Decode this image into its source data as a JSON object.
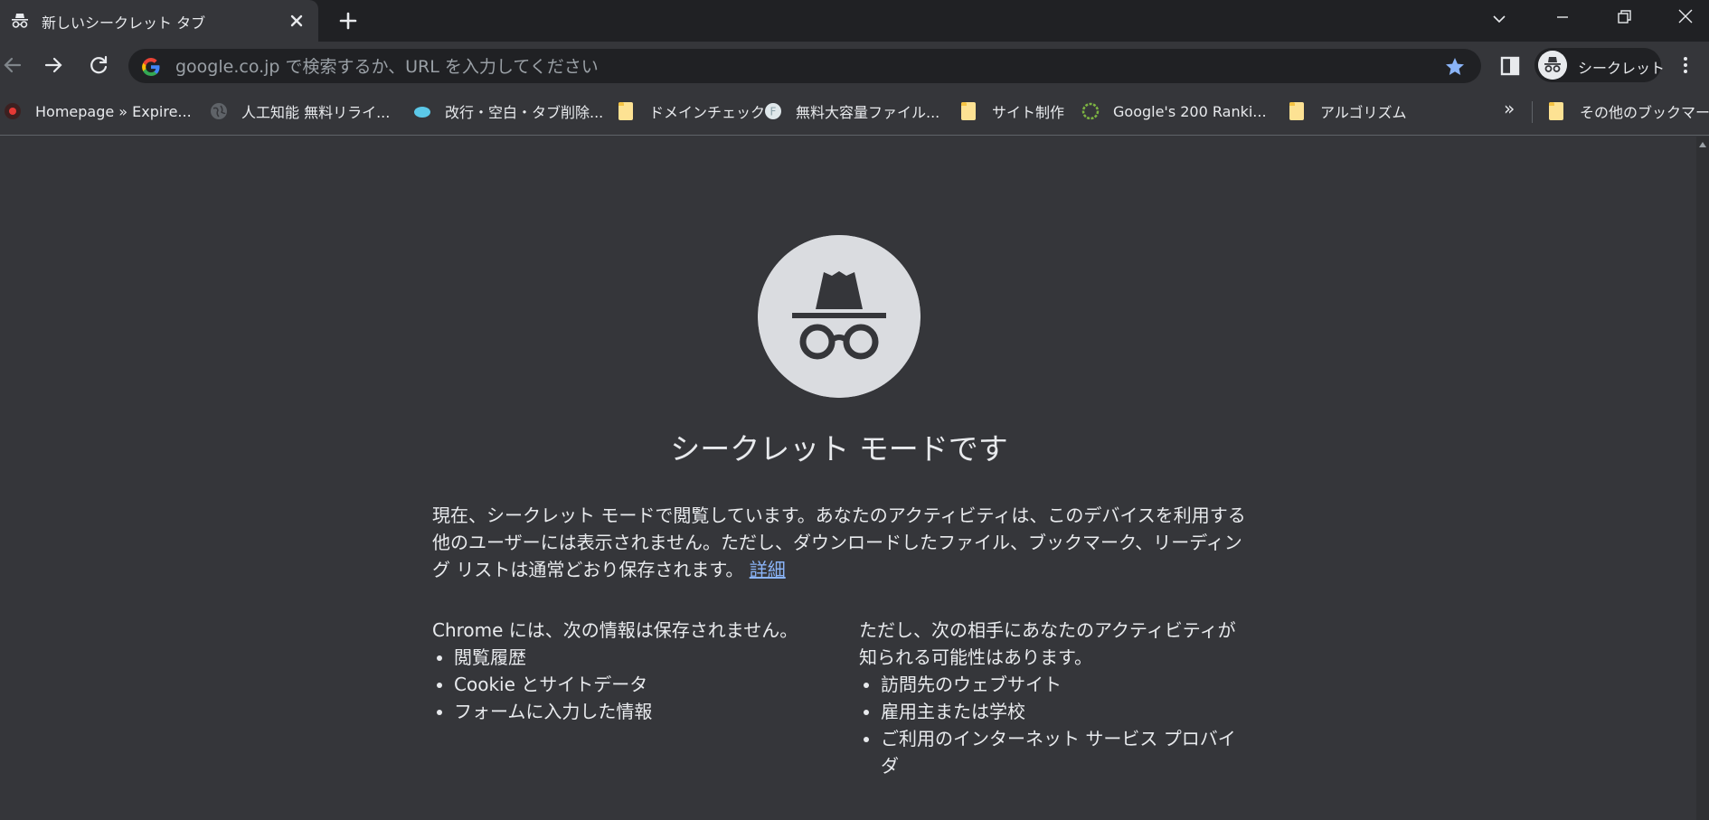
{
  "tab": {
    "title": "新しいシークレット タブ"
  },
  "omnibox": {
    "placeholder": "google.co.jp で検索するか、URL を入力してください"
  },
  "profile": {
    "label": "シークレット"
  },
  "bookmarks": [
    {
      "label": "Homepage » Expire...",
      "icon": "red-circle-icon"
    },
    {
      "label": "人工知能 無料リライ...",
      "icon": "globe-icon"
    },
    {
      "label": "改行・空白・タブ削除...",
      "icon": "cloud-icon"
    },
    {
      "label": "ドメインチェック",
      "icon": "folder-icon"
    },
    {
      "label": "無料大容量ファイル...",
      "icon": "f-circle-icon"
    },
    {
      "label": "サイト制作",
      "icon": "folder-icon"
    },
    {
      "label": "Google's 200 Ranki...",
      "icon": "green-ring-icon"
    },
    {
      "label": "アルゴリズム",
      "icon": "folder-icon"
    }
  ],
  "bookmarks_overflow": "»",
  "other_bookmarks": "その他のブックマーク",
  "page": {
    "heading": "シークレット モードです",
    "intro": "現在、シークレット モードで閲覧しています。あなたのアクティビティは、このデバイスを利用する他のユーザーには表示されません。ただし、ダウンロードしたファイル、ブックマーク、リーディング リストは通常どおり保存されます。",
    "learn_more": "詳細",
    "left_col": {
      "title": "Chrome には、次の情報は保存されません。",
      "items": [
        "閲覧履歴",
        "Cookie とサイトデータ",
        "フォームに入力した情報"
      ]
    },
    "right_col": {
      "title": "ただし、次の相手にあなたのアクティビティが知られる可能性はあります。",
      "items": [
        "訪問先のウェブサイト",
        "雇用主または学校",
        "ご利用のインターネット サービス プロバイダ"
      ]
    }
  },
  "colors": {
    "frame": "#202124",
    "toolbar": "#35363a",
    "text": "#e8eaed",
    "link": "#8ab4f8",
    "star": "#8ab4f8"
  }
}
